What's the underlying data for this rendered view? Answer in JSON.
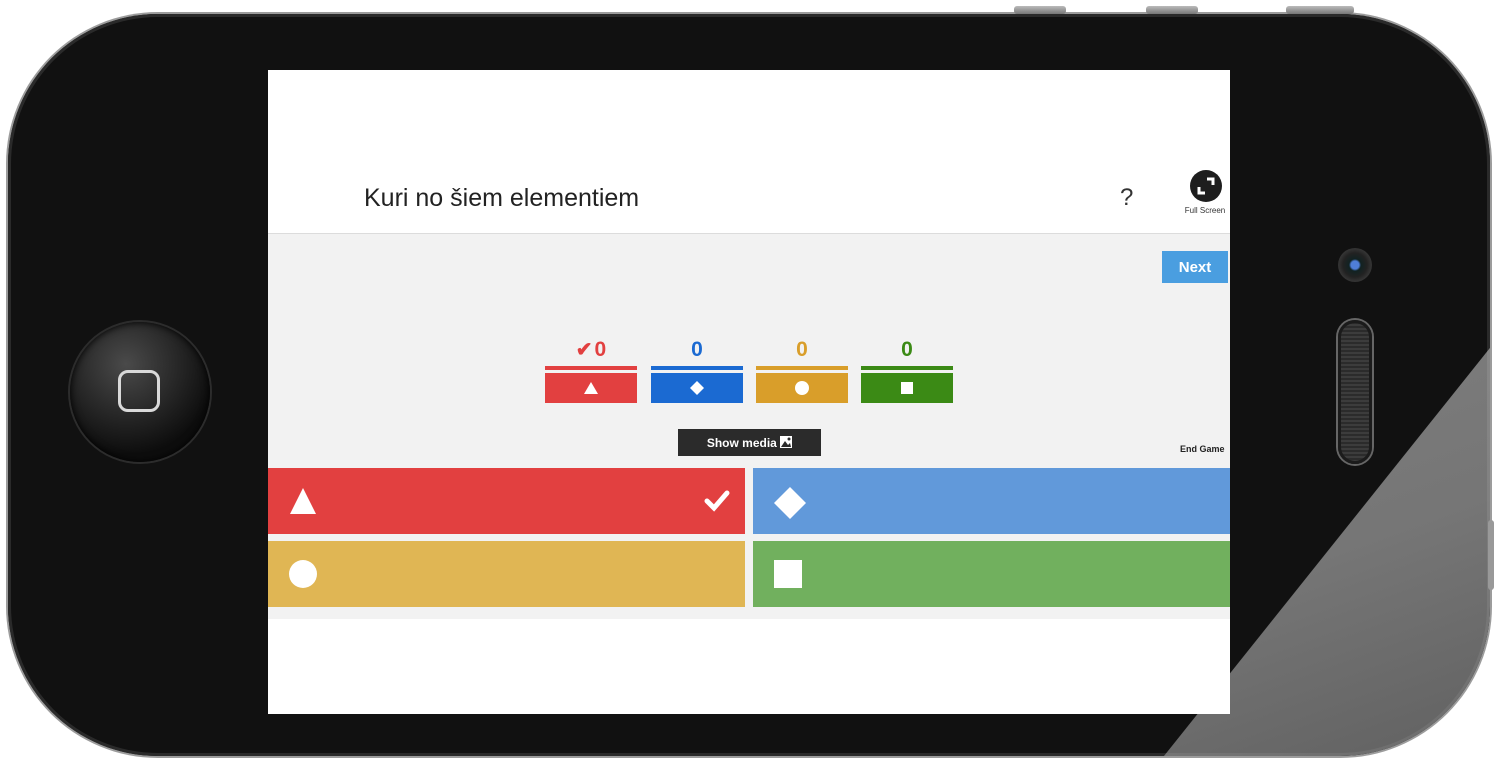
{
  "question": {
    "text": "Kuri no šiem elementiem",
    "help_label": "?"
  },
  "toolbar": {
    "fullscreen_label": "Full Screen",
    "next_label": "Next",
    "show_media_label": "Show media",
    "end_game_label": "End Game"
  },
  "results": [
    {
      "count": "0",
      "correct": true,
      "shape": "triangle-icon",
      "color": "#e24040"
    },
    {
      "count": "0",
      "correct": false,
      "shape": "diamond-icon",
      "color": "#1b6ad2"
    },
    {
      "count": "0",
      "correct": false,
      "shape": "circle-icon",
      "color": "#d99e2a"
    },
    {
      "count": "0",
      "correct": false,
      "shape": "square-icon",
      "color": "#3b8a15"
    }
  ],
  "answers": [
    {
      "shape": "triangle-icon",
      "color": "#e24040",
      "correct": true
    },
    {
      "shape": "diamond-icon",
      "color": "#6199da",
      "correct": false
    },
    {
      "shape": "circle-icon",
      "color": "#e0b654",
      "correct": false
    },
    {
      "shape": "square-icon",
      "color": "#71b05e",
      "correct": false
    }
  ],
  "colors": {
    "next_button": "#4a9ee0",
    "show_media_button": "#2b2b2b"
  }
}
